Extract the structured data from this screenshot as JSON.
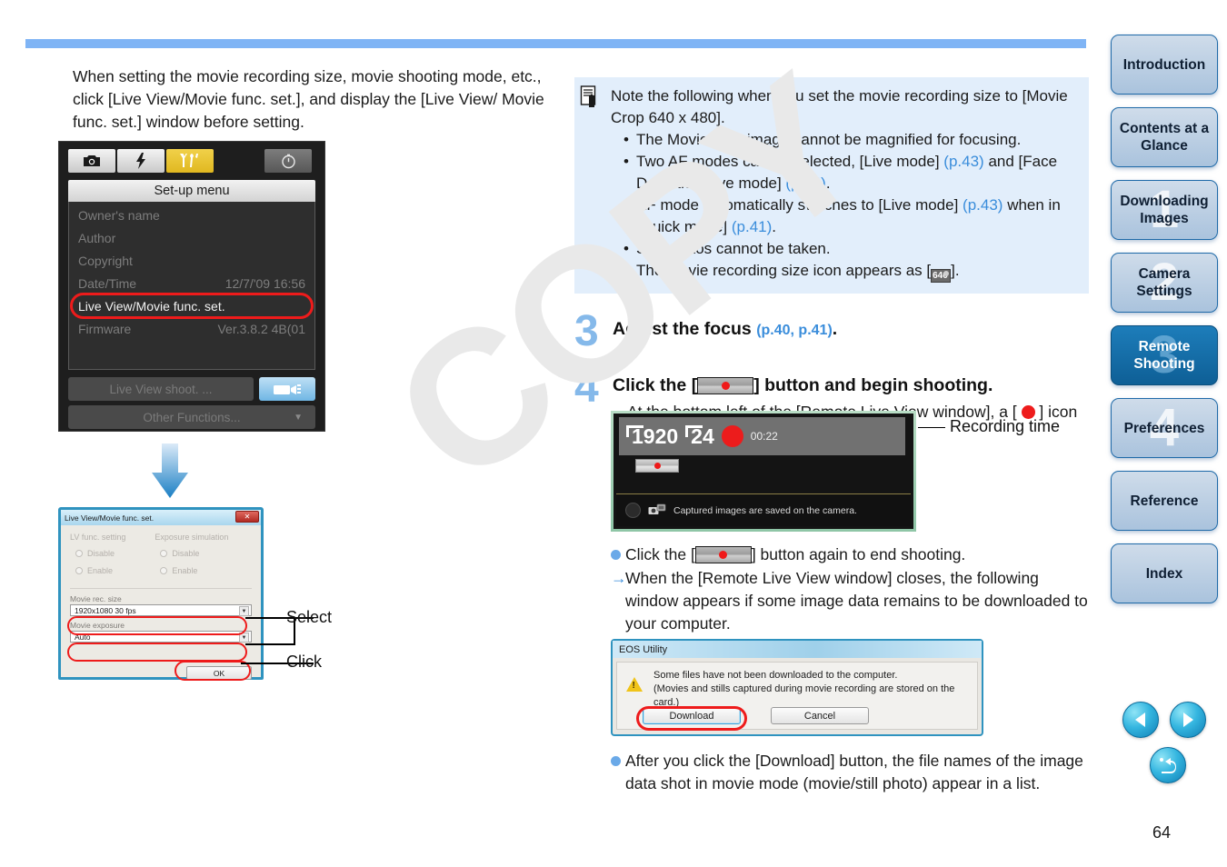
{
  "page": {
    "number": "64",
    "watermark": "COPY"
  },
  "left": {
    "intro_paragraph": "When setting the movie recording size, movie shooting mode, etc., click [Live View/Movie func. set.], and display the [Live View/ Movie func. set.] window before setting.",
    "camera_menu": {
      "title": "Set-up menu",
      "tab_icons": [
        "camera-icon",
        "flash-icon",
        "wrench-icon",
        "clock-icon"
      ],
      "rows": [
        {
          "label": "Owner's name",
          "value": ""
        },
        {
          "label": "Author",
          "value": ""
        },
        {
          "label": "Copyright",
          "value": ""
        },
        {
          "label": "Date/Time",
          "value": "12/7/'09  16:56"
        },
        {
          "label": "Live View/Movie func. set.",
          "value": "",
          "highlighted": true
        },
        {
          "label": "Firmware",
          "value": "Ver.3.8.2 4B(01"
        }
      ],
      "buttons": {
        "live_view_shoot": "Live View shoot. ...",
        "other_functions": "Other Functions..."
      }
    },
    "lv_dialog": {
      "title": "Live View/Movie func. set.",
      "close_label": "✕",
      "lv_func_setting": {
        "heading": "LV func. setting",
        "options": [
          "Disable",
          "Enable"
        ]
      },
      "exposure_simulation": {
        "heading": "Exposure simulation",
        "options": [
          "Disable",
          "Enable"
        ]
      },
      "movie_rec_size": {
        "label": "Movie rec. size",
        "value": "1920x1080  30 fps"
      },
      "movie_exposure": {
        "label": "Movie exposure",
        "value": "Auto"
      },
      "ok_label": "OK"
    },
    "callouts": {
      "select": "Select",
      "click": "Click"
    }
  },
  "right": {
    "note": {
      "intro": "Note the following when you set the movie recording size to [Movie Crop 640 x 480].",
      "bullets": [
        "The Movie crop image cannot be magnified for focusing.",
        "Two AF modes can be selected, [Live mode] (p.43) and [Face Detection Live mode] (p.44).",
        "AF mode automatically switches to [Live mode] (p.43) when in [Quick mode] (p.41).",
        "Still photos cannot be taken.",
        "The movie recording size icon appears as [ 640 ]."
      ],
      "icon": "note-icon",
      "size_icon_label": "640"
    },
    "step3": {
      "number": "3",
      "heading": "Adjust the focus",
      "refs": "(p.40, p.41)",
      "heading_end": "."
    },
    "step4": {
      "number": "4",
      "heading_before": "Click the [",
      "heading_after": "] button and begin shooting.",
      "arrow_text_a": "At the bottom left of the [Remote Live View window], a [",
      "arrow_text_b": "] icon and the recording time are displayed.",
      "bullet1_before": "Click the [",
      "bullet1_after": "] button again to end shooting.",
      "arrow2": "When the [Remote Live View window] closes, the following window appears if some image data remains to be downloaded to your computer.",
      "bullet2": "After you click the [Download] button, the file names of the image data shot in movie mode (movie/still photo) appear in a list."
    },
    "remote_live_view": {
      "resolution": "1920",
      "framerate": "24",
      "time": "00:22",
      "status_message": "Captured images are saved on the camera.",
      "recording_time_label": "Recording time"
    },
    "eos_dialog": {
      "title": "EOS Utility",
      "line1": "Some files have not been downloaded to the computer.",
      "line2": "(Movies and stills captured during movie recording are stored on the card.)",
      "download_label": "Download",
      "cancel_label": "Cancel"
    }
  },
  "sidebar": {
    "tabs": [
      {
        "label": "Introduction",
        "ghost": "",
        "active": false
      },
      {
        "label": "Contents at a Glance",
        "ghost": "",
        "active": false
      },
      {
        "label": "Downloading Images",
        "ghost": "1",
        "active": false
      },
      {
        "label": "Camera Settings",
        "ghost": "2",
        "active": false
      },
      {
        "label": "Remote Shooting",
        "ghost": "3",
        "active": true
      },
      {
        "label": "Preferences",
        "ghost": "4",
        "active": false
      },
      {
        "label": "Reference",
        "ghost": "",
        "active": false
      },
      {
        "label": "Index",
        "ghost": "",
        "active": false
      }
    ],
    "nav": {
      "prev": "previous-page-arrow-icon",
      "next": "next-page-arrow-icon",
      "back": "return-icon"
    }
  },
  "colors": {
    "accent": "#7fb4f5",
    "active_tab": "#1d7dba",
    "link": "#3a8ddb",
    "note_bg": "#e2eefb",
    "highlight_ring": "#ee1b1b"
  }
}
